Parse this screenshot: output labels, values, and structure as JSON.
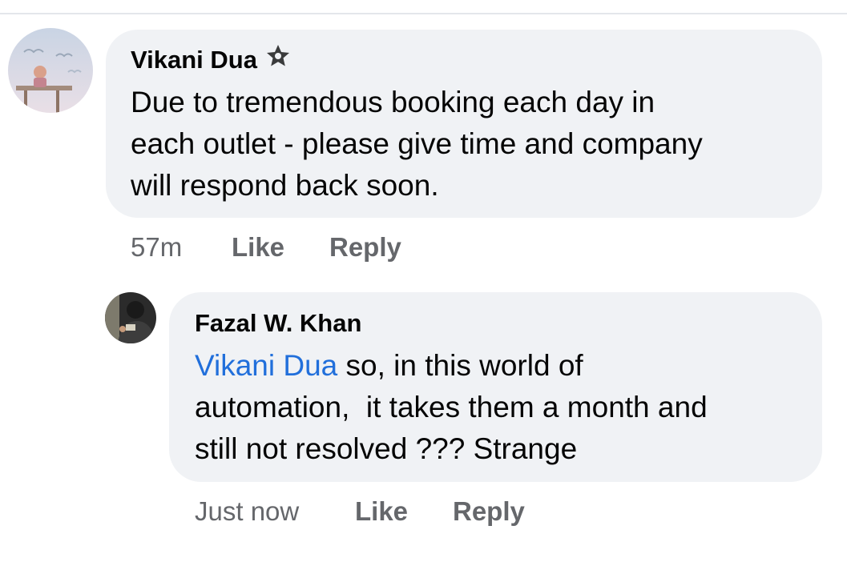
{
  "comment": {
    "author": "Vikani Dua",
    "author_badge_icon": "top-fan-star-icon",
    "lines": [
      "Due to tremendous booking each day in",
      "each outlet - please give time and company",
      "will respond back soon."
    ],
    "time": "57m",
    "like_label": "Like",
    "reply_label": "Reply"
  },
  "reply": {
    "author": "Fazal W. Khan",
    "mention": "Vikani Dua",
    "line1_rest": " so, in this world of",
    "line2": "automation,  it takes them a month and",
    "line3": "still not resolved ??? Strange",
    "time": "Just now",
    "like_label": "Like",
    "reply_label": "Reply"
  },
  "colors": {
    "bubble": "#f0f2f5",
    "mention": "#216fdb",
    "meta": "#65676b"
  }
}
